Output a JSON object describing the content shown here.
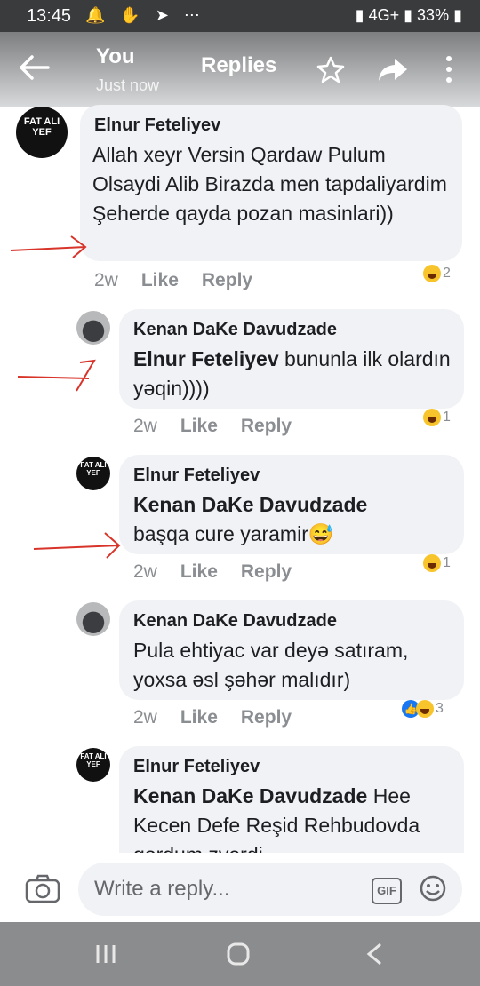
{
  "status_bar": {
    "time": "13:45",
    "left_icons": "🔔 ✋ ➤ ⋯",
    "battery": "33%",
    "network": "4G+"
  },
  "header": {
    "title": "You",
    "subtitle": "Just now",
    "center": "Replies"
  },
  "comments": [
    {
      "author": "Elnur Feteliyev",
      "text": "Allah xeyr Versin Qardaw Pulum Olsaydi Alib Birazda men tapdaliyardim Şeherde qayda pozan masinlari))",
      "time": "2w",
      "like": "Like",
      "reply": "Reply",
      "reactions": "2",
      "avatar_text": "FAT ALI YEF"
    },
    {
      "author": "Kenan DaKe Davudzade",
      "mention": "Elnur Feteliyev",
      "text": " bununla ilk olardın yəqin))))",
      "time": "2w",
      "like": "Like",
      "reply": "Reply",
      "reactions": "1"
    },
    {
      "author": "Elnur Feteliyev",
      "mention": "Kenan DaKe Davudzade",
      "text": "başqa cure yaramir😅",
      "time": "2w",
      "like": "Like",
      "reply": "Reply",
      "reactions": "1",
      "avatar_text": "FAT ALI YEF"
    },
    {
      "author": "Kenan DaKe Davudzade",
      "text": "Pula ehtiyac var deyə satıram, yoxsa əsl şəhər malıdır)",
      "time": "2w",
      "like": "Like",
      "reply": "Reply",
      "reactions": "3"
    },
    {
      "author": "Elnur Feteliyev",
      "mention": "Kenan DaKe Davudzade",
      "text": " Hee Kecen Defe Reşid Rehbudovda gordum zverdi",
      "avatar_text": "FAT ALI YEF"
    }
  ],
  "composer": {
    "placeholder": "Write a reply...",
    "gif_label": "GIF"
  },
  "icons": {
    "back": "arrow-left-icon",
    "star": "star-icon",
    "share": "share-arrow-icon",
    "more": "more-vertical-icon",
    "camera": "camera-icon",
    "emoji": "emoji-icon"
  }
}
